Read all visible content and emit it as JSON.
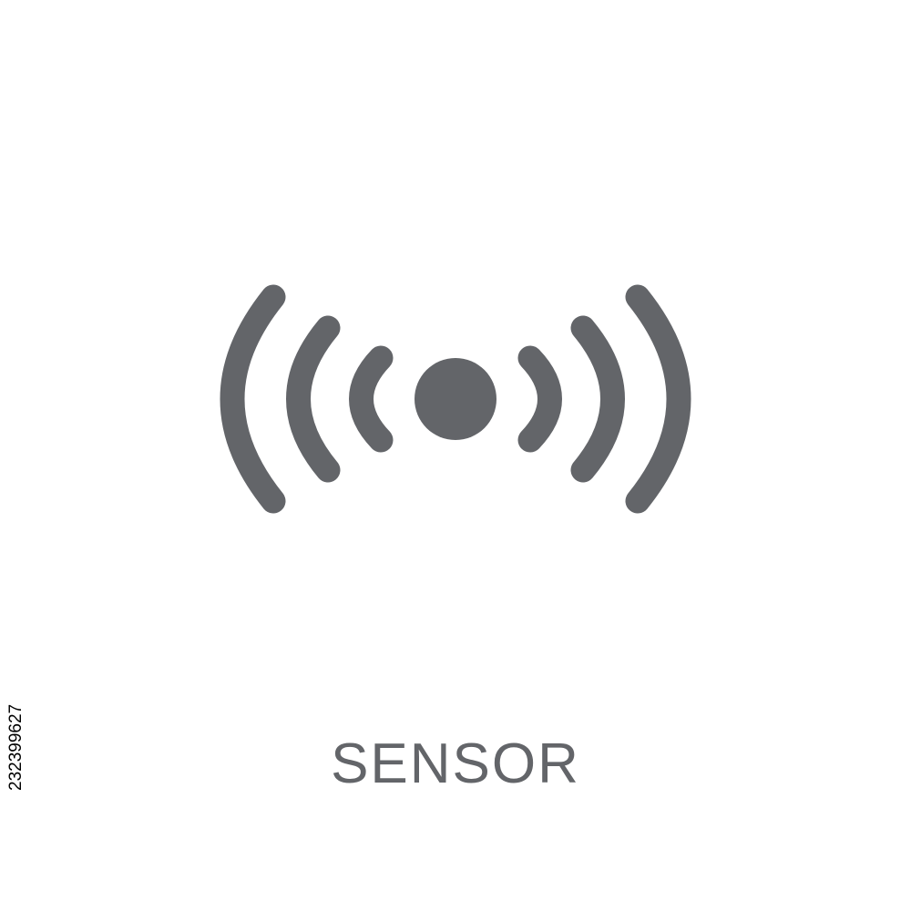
{
  "image": {
    "icon": "sensor-waves-icon",
    "caption": "SENSOR",
    "stock_id": "232399627"
  },
  "colors": {
    "background": "#ffffff",
    "icon": "#636569",
    "caption": "#636569"
  }
}
